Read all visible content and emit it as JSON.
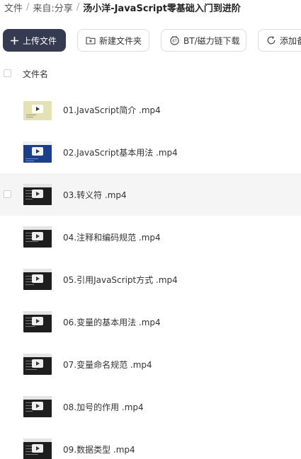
{
  "breadcrumb": {
    "root": "文件",
    "from": "来自:",
    "share": "分享",
    "current": "汤小洋-JavaScript零基础入门到进阶"
  },
  "toolbar": {
    "upload_label": "上传文件",
    "new_folder_label": "新建文件夹",
    "bt_label": "BT/磁力链下载",
    "offline_label": "添加备"
  },
  "list": {
    "column_name": "文件名",
    "files": [
      {
        "name": "01.JavaScript简介 .mp4",
        "icon": "video-thumbnail"
      },
      {
        "name": "02.JavaScript基本用法 .mp4",
        "icon": "video-thumbnail"
      },
      {
        "name": "03.转义符 .mp4",
        "icon": "video-thumbnail"
      },
      {
        "name": "04.注释和编码规范 .mp4",
        "icon": "video-thumbnail"
      },
      {
        "name": "05.引用JavaScript方式 .mp4",
        "icon": "video-thumbnail"
      },
      {
        "name": "06.变量的基本用法 .mp4",
        "icon": "video-thumbnail"
      },
      {
        "name": "07.变量命名规范 .mp4",
        "icon": "video-thumbnail"
      },
      {
        "name": "08.加号的作用 .mp4",
        "icon": "video-thumbnail"
      },
      {
        "name": "09.数据类型 .mp4",
        "icon": "video-thumbnail"
      }
    ]
  },
  "colors": {
    "primary_button": "#373b52",
    "hover_row": "#f5f5f5"
  }
}
